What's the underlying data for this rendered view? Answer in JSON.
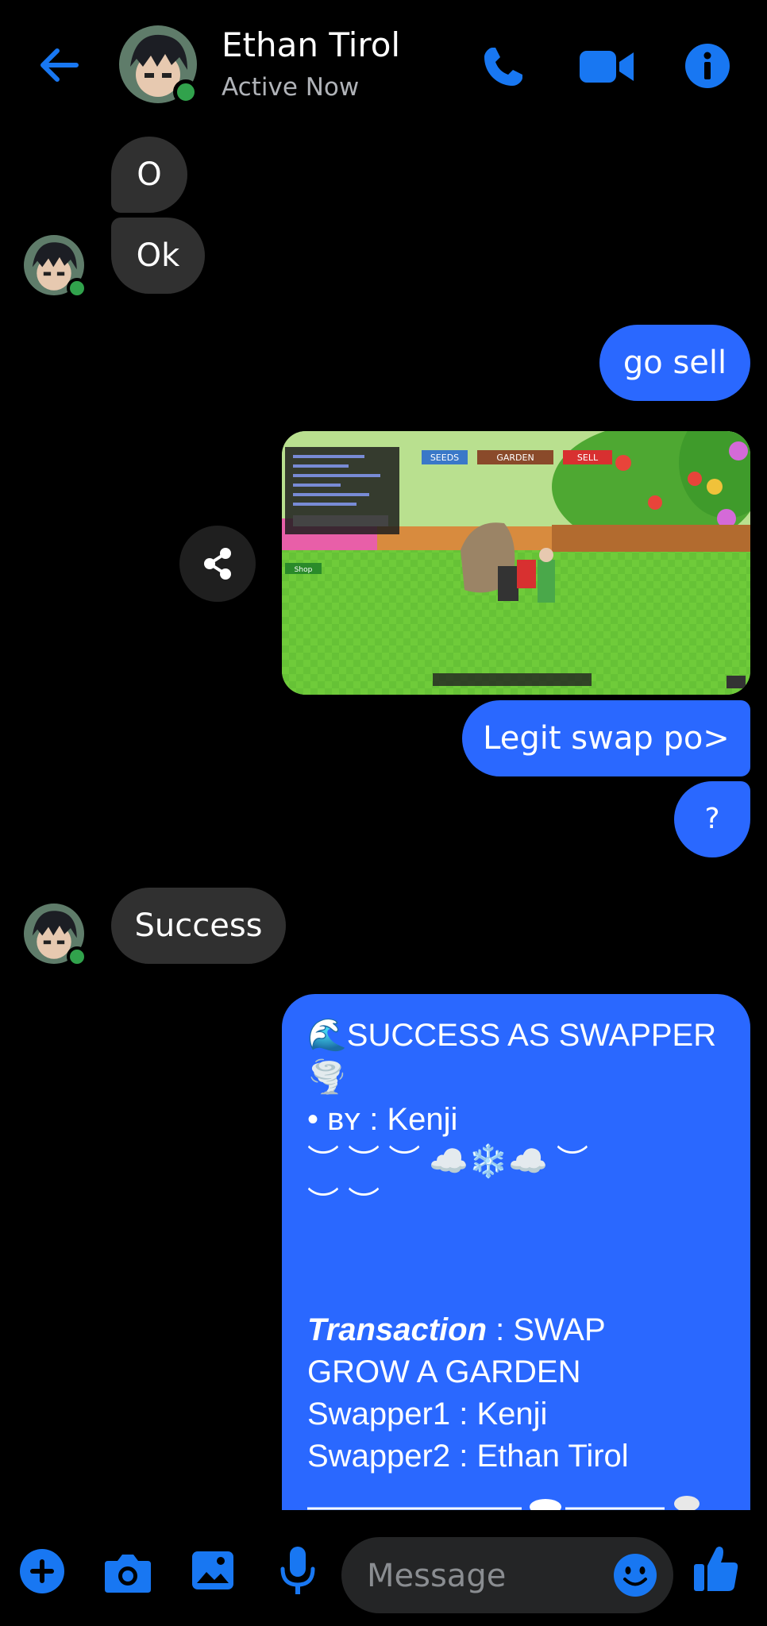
{
  "header": {
    "contact_name": "Ethan Tirol",
    "status": "Active Now",
    "icons": [
      "back-arrow-icon",
      "phone-icon",
      "video-camera-icon",
      "info-icon"
    ]
  },
  "messages": [
    {
      "id": "m1",
      "sender": "contact",
      "text": "O"
    },
    {
      "id": "m2",
      "sender": "contact",
      "text": "Ok"
    },
    {
      "id": "m3",
      "sender": "me",
      "text": "go sell"
    },
    {
      "id": "m4",
      "sender": "me",
      "type": "image",
      "image_labels": {
        "seeds": "SEEDS",
        "garden": "GARDEN",
        "sell": "SELL",
        "shop": "Shop"
      }
    },
    {
      "id": "m5",
      "sender": "me",
      "text": "Legit swap po>"
    },
    {
      "id": "m6",
      "sender": "me",
      "text": "?"
    },
    {
      "id": "m7",
      "sender": "contact",
      "text": "Success"
    },
    {
      "id": "m8",
      "sender": "me",
      "lines": [
        "🌊SUCCESS AS SWAPPER",
        "🌪️",
        "• ʙʏ : Kenji",
        "︶ ︶ ︶ ☁️❄️☁️ ︶",
        "︶ ︶",
        "",
        "Transaction",
        " : SWAP",
        "GROW A GARDEN",
        "Swapper1 : Kenji",
        "Swapper2 : Ethan Tirol"
      ]
    }
  ],
  "composer": {
    "placeholder": "Message",
    "icons": [
      "plus-icon",
      "camera-icon",
      "gallery-icon",
      "microphone-icon",
      "emoji-icon",
      "thumbs-up-icon"
    ]
  },
  "colors": {
    "accent": "#2a68ff",
    "icon_blue": "#1877f2",
    "incoming_bubble": "#303030",
    "background": "#000000",
    "online": "#31a24c"
  }
}
